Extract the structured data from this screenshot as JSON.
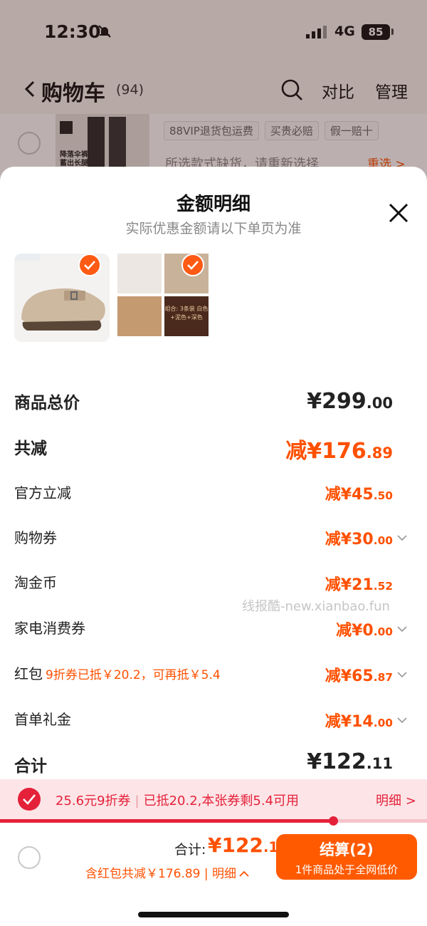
{
  "status_bar": {
    "time": "12:30",
    "network": "4G",
    "battery": "85"
  },
  "nav": {
    "back_label": "购物车",
    "count": "(94)",
    "compare": "对比",
    "manage": "管理"
  },
  "background_item": {
    "tags": [
      "88VIP退货包运费",
      "买贵必赔",
      "假一赔十"
    ],
    "warning": "所选款式缺货，请重新选择",
    "reselect": "重选 >",
    "thumb_text": "降落伞裤 蓄出长腿"
  },
  "sheet": {
    "title": "金额明细",
    "subtitle": "实际优惠金额请以下单页为准",
    "product2_text": "组合: 3条装 白色+泥色+深色"
  },
  "rows": {
    "total_price": {
      "label": "商品总价",
      "prefix": "¥",
      "int": "299",
      "dec": ".00"
    },
    "total_reduce": {
      "label": "共减",
      "prefix": "减¥",
      "int": "176",
      "dec": ".89"
    },
    "items": [
      {
        "label": "官方立减",
        "prefix": "减¥",
        "int": "45",
        "dec": ".50",
        "note": "",
        "chevron": false
      },
      {
        "label": "购物券",
        "prefix": "减¥",
        "int": "30",
        "dec": ".00",
        "note": "",
        "chevron": true
      },
      {
        "label": "淘金币",
        "prefix": "减¥",
        "int": "21",
        "dec": ".52",
        "note": "",
        "chevron": false
      },
      {
        "label": "家电消费券",
        "prefix": "减¥",
        "int": "0",
        "dec": ".00",
        "note": "",
        "chevron": true
      },
      {
        "label": "红包",
        "prefix": "减¥",
        "int": "65",
        "dec": ".87",
        "note": "9折券已抵￥20.2，可再抵￥5.4",
        "chevron": true
      },
      {
        "label": "首单礼金",
        "prefix": "减¥",
        "int": "14",
        "dec": ".00",
        "note": "",
        "chevron": true
      }
    ],
    "sum": {
      "label": "合计",
      "prefix": "¥",
      "int": "122",
      "dec": ".11"
    }
  },
  "watermark": "线报酷-new.xianbao.fun",
  "coupon_bar": {
    "coupon_name": "25.6元9折券",
    "coupon_status": "已抵20.2,本张券剩5.4可用",
    "detail": "明细 >",
    "progress_fraction": 0.78
  },
  "bottom": {
    "sum_label": "合计:",
    "sum_prefix": "¥",
    "sum_int": "122",
    "sum_dec": ".11",
    "sub_text": "含红包共减￥176.89 | 明细",
    "checkout_label": "结算(2)",
    "checkout_sub": "1件商品处于全网低价"
  },
  "colors": {
    "accent": "#ff5000",
    "coupon_red": "#e5213a",
    "checkout": "#ff5a00"
  }
}
